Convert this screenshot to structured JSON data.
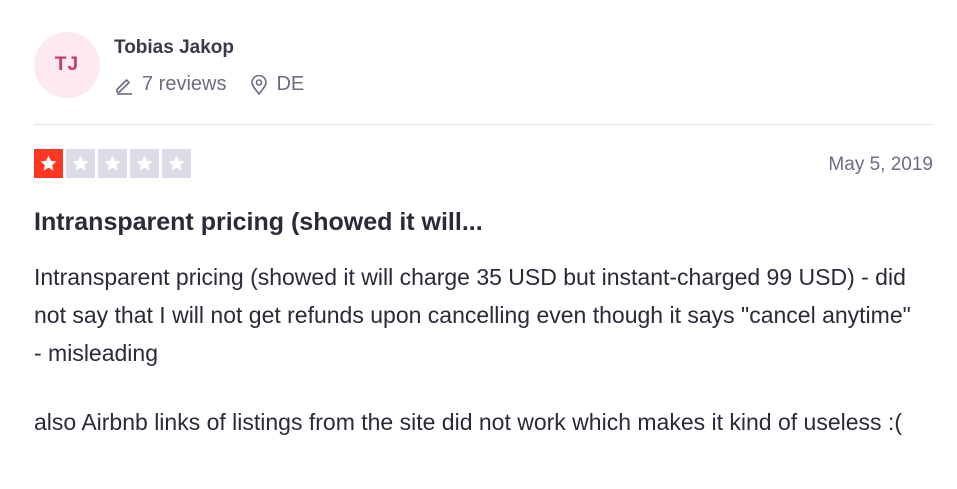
{
  "reviewer": {
    "initials": "TJ",
    "name": "Tobias Jakop",
    "reviews_count": "7 reviews",
    "country": "DE",
    "avatar_bg": "#fde9f0",
    "avatar_fg": "#c4386d"
  },
  "review": {
    "rating": 1,
    "rating_max": 5,
    "rating_color": "#ff3722",
    "date": "May 5, 2019",
    "title": "Intransparent pricing (showed it will...",
    "paragraphs": [
      "Intransparent pricing (showed it will charge 35 USD but instant-charged 99 USD) - did not say that I will not get refunds upon cancelling even though it says \"cancel anytime\" - misleading",
      "also Airbnb links of listings from the site did not work which makes it kind of useless :("
    ]
  },
  "icons": {
    "reviews": "pencil-icon",
    "country": "location-pin-icon",
    "star": "star-icon"
  }
}
